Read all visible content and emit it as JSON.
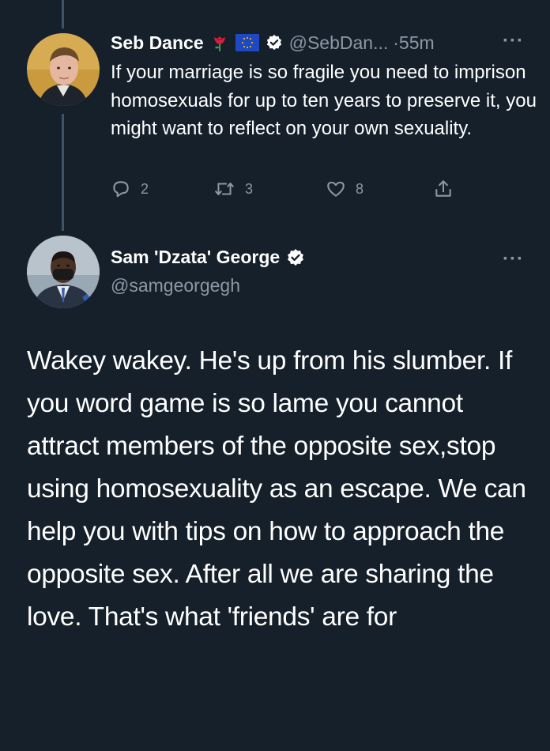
{
  "tweet1": {
    "display_name": "Seb Dance",
    "emoji": [
      "rose",
      "eu-flag"
    ],
    "handle": "@SebDan...",
    "time": "·55m",
    "more": "···",
    "body": "If your marriage is so fragile you need to imprison homosexuals for up to ten years to preserve it, you might want to reflect on your own sexuality.",
    "actions": {
      "reply_count": "2",
      "retweet_count": "3",
      "like_count": "8"
    }
  },
  "tweet2": {
    "display_name": "Sam 'Dzata' George",
    "handle": "@samgeorgegh",
    "more": "···",
    "body": "Wakey wakey. He's up from his slumber. If you word game is so lame you cannot attract members of the opposite sex,stop using homosexuality as an escape. We can help you with tips on how to approach the opposite sex. After all we are sharing the love. That's what 'friends' are for"
  },
  "icons": {
    "reply": "reply-icon",
    "retweet": "retweet-icon",
    "like": "like-icon",
    "share": "share-icon",
    "verified": "verified-badge-icon"
  },
  "colors": {
    "background": "#15202b",
    "text": "#ffffff",
    "secondary_text": "#8b98a5",
    "thread_line": "#3d5466"
  }
}
